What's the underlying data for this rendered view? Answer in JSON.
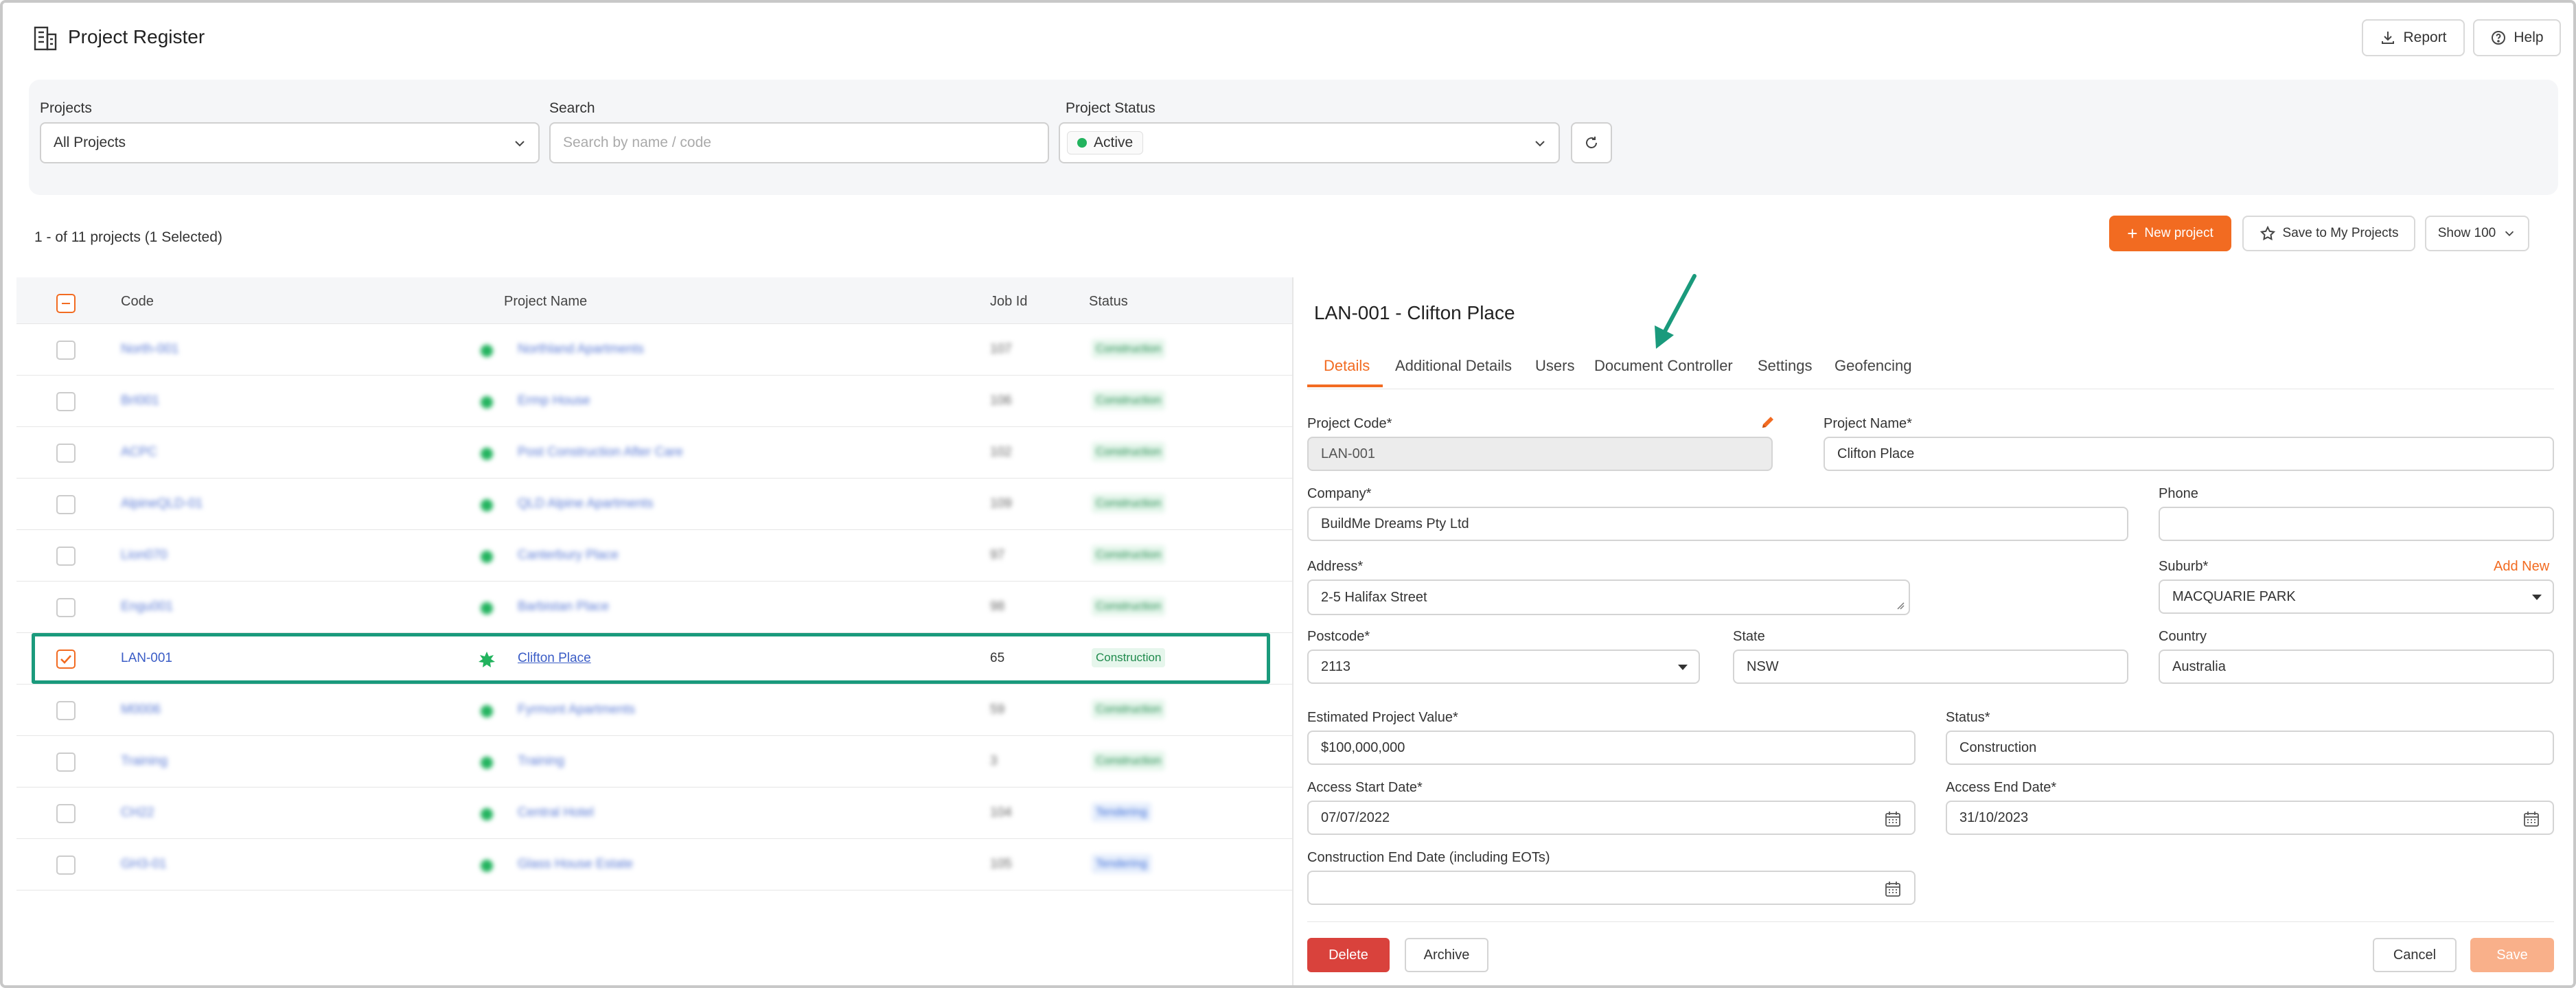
{
  "header": {
    "title": "Project Register",
    "report_label": "Report",
    "help_label": "Help"
  },
  "filters": {
    "projects_label": "Projects",
    "projects_value": "All Projects",
    "search_label": "Search",
    "search_placeholder": "Search by name / code",
    "status_label": "Project Status",
    "status_value": "Active"
  },
  "toolbar": {
    "count_text": "1 - of 11 projects (1 Selected)",
    "new_project_label": "New project",
    "save_to_my_projects_label": "Save to My Projects",
    "show_label": "Show 100"
  },
  "table": {
    "columns": [
      "Code",
      "Project Name",
      "Job Id",
      "Status"
    ],
    "rows": [
      {
        "code": "North-001",
        "name": "Northland Apartments",
        "job_id": "107",
        "status": "Construction",
        "selected": false
      },
      {
        "code": "BrI001",
        "name": "Ermp House",
        "job_id": "106",
        "status": "Construction",
        "selected": false
      },
      {
        "code": "ACPC",
        "name": "Post Construction After Care",
        "job_id": "102",
        "status": "Construction",
        "selected": false
      },
      {
        "code": "AlpineQLD-01",
        "name": "QLD Alpine Apartments",
        "job_id": "109",
        "status": "Construction",
        "selected": false
      },
      {
        "code": "Lion070",
        "name": "Canterbury Place",
        "job_id": "97",
        "status": "Construction",
        "selected": false
      },
      {
        "code": "Engu001",
        "name": "Barbistan Place",
        "job_id": "98",
        "status": "Construction",
        "selected": false
      },
      {
        "code": "LAN-001",
        "name": "Clifton Place",
        "job_id": "65",
        "status": "Construction",
        "selected": true
      },
      {
        "code": "M0006",
        "name": "Fyrmont Apartments",
        "job_id": "59",
        "status": "Construction",
        "selected": false
      },
      {
        "code": "Training",
        "name": "Training",
        "job_id": "3",
        "status": "Construction",
        "selected": false
      },
      {
        "code": "CH22",
        "name": "Central Hotel",
        "job_id": "104",
        "status": "Tendering",
        "selected": false
      },
      {
        "code": "GH3-01",
        "name": "Glass House Estate",
        "job_id": "105",
        "status": "Tendering",
        "selected": false
      }
    ]
  },
  "detail": {
    "title": "LAN-001 - Clifton Place",
    "tabs": [
      "Details",
      "Additional Details",
      "Users",
      "Document Controller",
      "Settings",
      "Geofencing"
    ],
    "active_tab": "Details",
    "fields": {
      "project_code": {
        "label": "Project Code*",
        "value": "LAN-001"
      },
      "project_name": {
        "label": "Project Name*",
        "value": "Clifton Place"
      },
      "company": {
        "label": "Company*",
        "value": "BuildMe Dreams Pty Ltd"
      },
      "phone": {
        "label": "Phone",
        "value": ""
      },
      "address": {
        "label": "Address*",
        "value": "2-5 Halifax Street"
      },
      "suburb": {
        "label": "Suburb*",
        "value": "MACQUARIE PARK",
        "add_new": "Add New"
      },
      "postcode": {
        "label": "Postcode*",
        "value": "2113"
      },
      "state": {
        "label": "State",
        "value": "NSW"
      },
      "country": {
        "label": "Country",
        "value": "Australia"
      },
      "estimated_value": {
        "label": "Estimated Project Value*",
        "value": "$100,000,000"
      },
      "status": {
        "label": "Status*",
        "value": "Construction"
      },
      "access_start": {
        "label": "Access Start Date*",
        "value": "07/07/2022"
      },
      "access_end": {
        "label": "Access End Date*",
        "value": "31/10/2023"
      },
      "construction_end": {
        "label": "Construction End Date (including EOTs)",
        "value": ""
      }
    },
    "buttons": {
      "delete": "Delete",
      "archive": "Archive",
      "cancel": "Cancel",
      "save": "Save"
    }
  },
  "colors": {
    "accent": "#f26b21",
    "highlight": "#1a9a7c",
    "status_active": "#22b35e",
    "danger": "#d9423c"
  }
}
